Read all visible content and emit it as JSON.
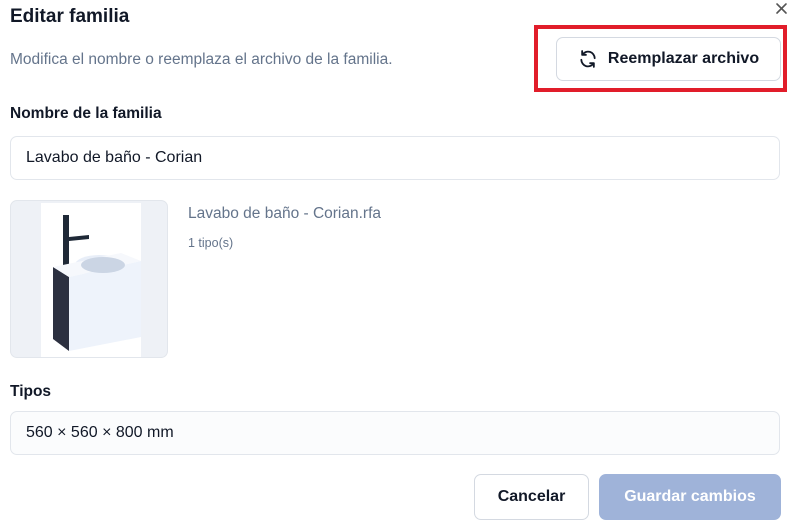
{
  "dialog": {
    "title": "Editar familia",
    "subtitle": "Modifica el nombre o reemplaza el archivo de la familia.",
    "close_icon": "close-icon",
    "close_glyph": "×"
  },
  "replace_button": {
    "label": "Reemplazar archivo",
    "icon": "refresh-icon"
  },
  "name_field": {
    "label": "Nombre de la familia",
    "value": "Lavabo de baño - Corian"
  },
  "file": {
    "name": "Lavabo de baño - Corian.rfa",
    "type_count": "1 tipo(s)",
    "thumbnail": "sink-thumbnail"
  },
  "types_field": {
    "label": "Tipos",
    "value": "560 × 560 × 800 mm"
  },
  "footer": {
    "cancel_label": "Cancelar",
    "save_label": "Guardar cambios"
  },
  "colors": {
    "highlight_border": "#e11d2a",
    "muted_text": "#64748b",
    "primary_disabled": "#9fb3d9"
  }
}
